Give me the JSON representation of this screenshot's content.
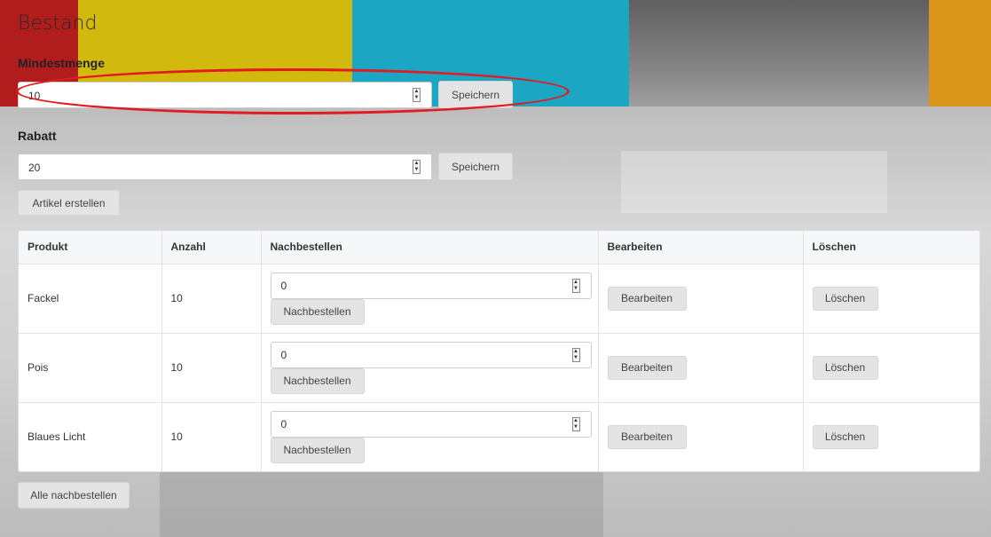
{
  "page": {
    "title": "Bestand"
  },
  "mindestmenge": {
    "label": "Mindestmenge",
    "value": "10",
    "save_label": "Speichern"
  },
  "rabatt": {
    "label": "Rabatt",
    "value": "20",
    "save_label": "Speichern"
  },
  "create_article_label": "Artikel erstellen",
  "table": {
    "headers": [
      "Produkt",
      "Anzahl",
      "Nachbestellen",
      "Bearbeiten",
      "Löschen"
    ],
    "rows": [
      {
        "produkt": "Fackel",
        "anzahl": "10",
        "nachbestellen_value": "0",
        "nachbestellen_label": "Nachbestellen",
        "bearbeiten_label": "Bearbeiten",
        "loeschen_label": "Löschen"
      },
      {
        "produkt": "Pois",
        "anzahl": "10",
        "nachbestellen_value": "0",
        "nachbestellen_label": "Nachbestellen",
        "bearbeiten_label": "Bearbeiten",
        "loeschen_label": "Löschen"
      },
      {
        "produkt": "Blaues Licht",
        "anzahl": "10",
        "nachbestellen_value": "0",
        "nachbestellen_label": "Nachbestellen",
        "bearbeiten_label": "Bearbeiten",
        "loeschen_label": "Löschen"
      }
    ]
  },
  "reorder_all_label": "Alle nachbestellen",
  "colors": {
    "highlight_ellipse": "#e21b23",
    "button_bg": "#e4e4e4",
    "table_header_bg": "#f6f7f8"
  }
}
